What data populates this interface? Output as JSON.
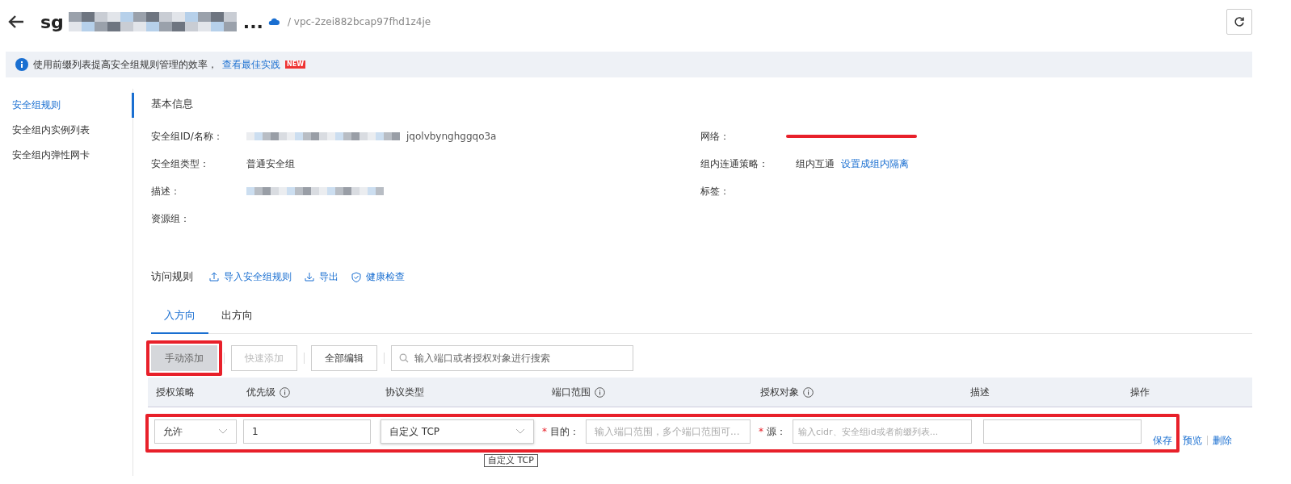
{
  "header": {
    "title_prefix": "sg",
    "title_suffix": "...",
    "breadcrumb": "/ vpc-2zei882bcap97fhd1z4je"
  },
  "notice": {
    "text": "使用前缀列表提高安全组规则管理的效率，",
    "link": "查看最佳实践",
    "badge": "NEW"
  },
  "sidebar": {
    "items": [
      {
        "label": "安全组规则",
        "selected": true
      },
      {
        "label": "安全组内实例列表",
        "selected": false
      },
      {
        "label": "安全组内弹性网卡",
        "selected": false
      }
    ]
  },
  "basic_info": {
    "title": "基本信息",
    "left": [
      {
        "label": "安全组ID/名称：",
        "kind": "redacted",
        "value": "jqolvbynghggqo3a"
      },
      {
        "label": "安全组类型：",
        "kind": "text",
        "value": "普通安全组"
      },
      {
        "label": "描述：",
        "kind": "redacted"
      },
      {
        "label": "资源组：",
        "kind": "empty"
      }
    ],
    "right": [
      {
        "label": "网络：",
        "kind": "struck"
      },
      {
        "label": "组内连通策略：",
        "kind": "link",
        "value": "组内互通",
        "link": "设置成组内隔离"
      },
      {
        "label": "标签：",
        "kind": "empty"
      }
    ]
  },
  "rules": {
    "title": "访问规则",
    "actions": [
      {
        "label": "导入安全组规则",
        "kind": "upload"
      },
      {
        "label": "导出",
        "kind": "download"
      },
      {
        "label": "健康检查",
        "kind": "shield"
      }
    ],
    "tabs": [
      {
        "label": "入方向",
        "selected": true
      },
      {
        "label": "出方向",
        "selected": false
      }
    ],
    "toolbar": [
      {
        "label": "手动添加",
        "disabled": true,
        "highlighted": true,
        "filled": true
      },
      {
        "label": "快速添加",
        "disabled": true,
        "highlighted": false,
        "filled": false
      },
      {
        "label": "全部编辑",
        "disabled": false,
        "highlighted": false,
        "filled": false
      }
    ],
    "search": {
      "placeholder": "输入端口或者授权对象进行搜索"
    },
    "columns": [
      {
        "label": "授权策略",
        "info": false
      },
      {
        "label": "优先级",
        "info": true
      },
      {
        "label": "协议类型",
        "info": false
      },
      {
        "label": "端口范围",
        "info": true
      },
      {
        "label": "授权对象",
        "info": true
      },
      {
        "label": "描述",
        "info": false
      },
      {
        "label": "操作",
        "info": false
      }
    ],
    "edit_row": {
      "policy": "允许",
      "priority": "1",
      "protocol": "自定义 TCP",
      "dest_label": "目的：",
      "dest_placeholder": "输入端口范围，多个端口范围可...",
      "source_label": "源：",
      "source_placeholder": "输入cidr、安全组id或者前缀列表...",
      "required_mark": "*",
      "actions": [
        "保存",
        "预览",
        "删除"
      ]
    },
    "tooltip": "自定义 TCP"
  }
}
